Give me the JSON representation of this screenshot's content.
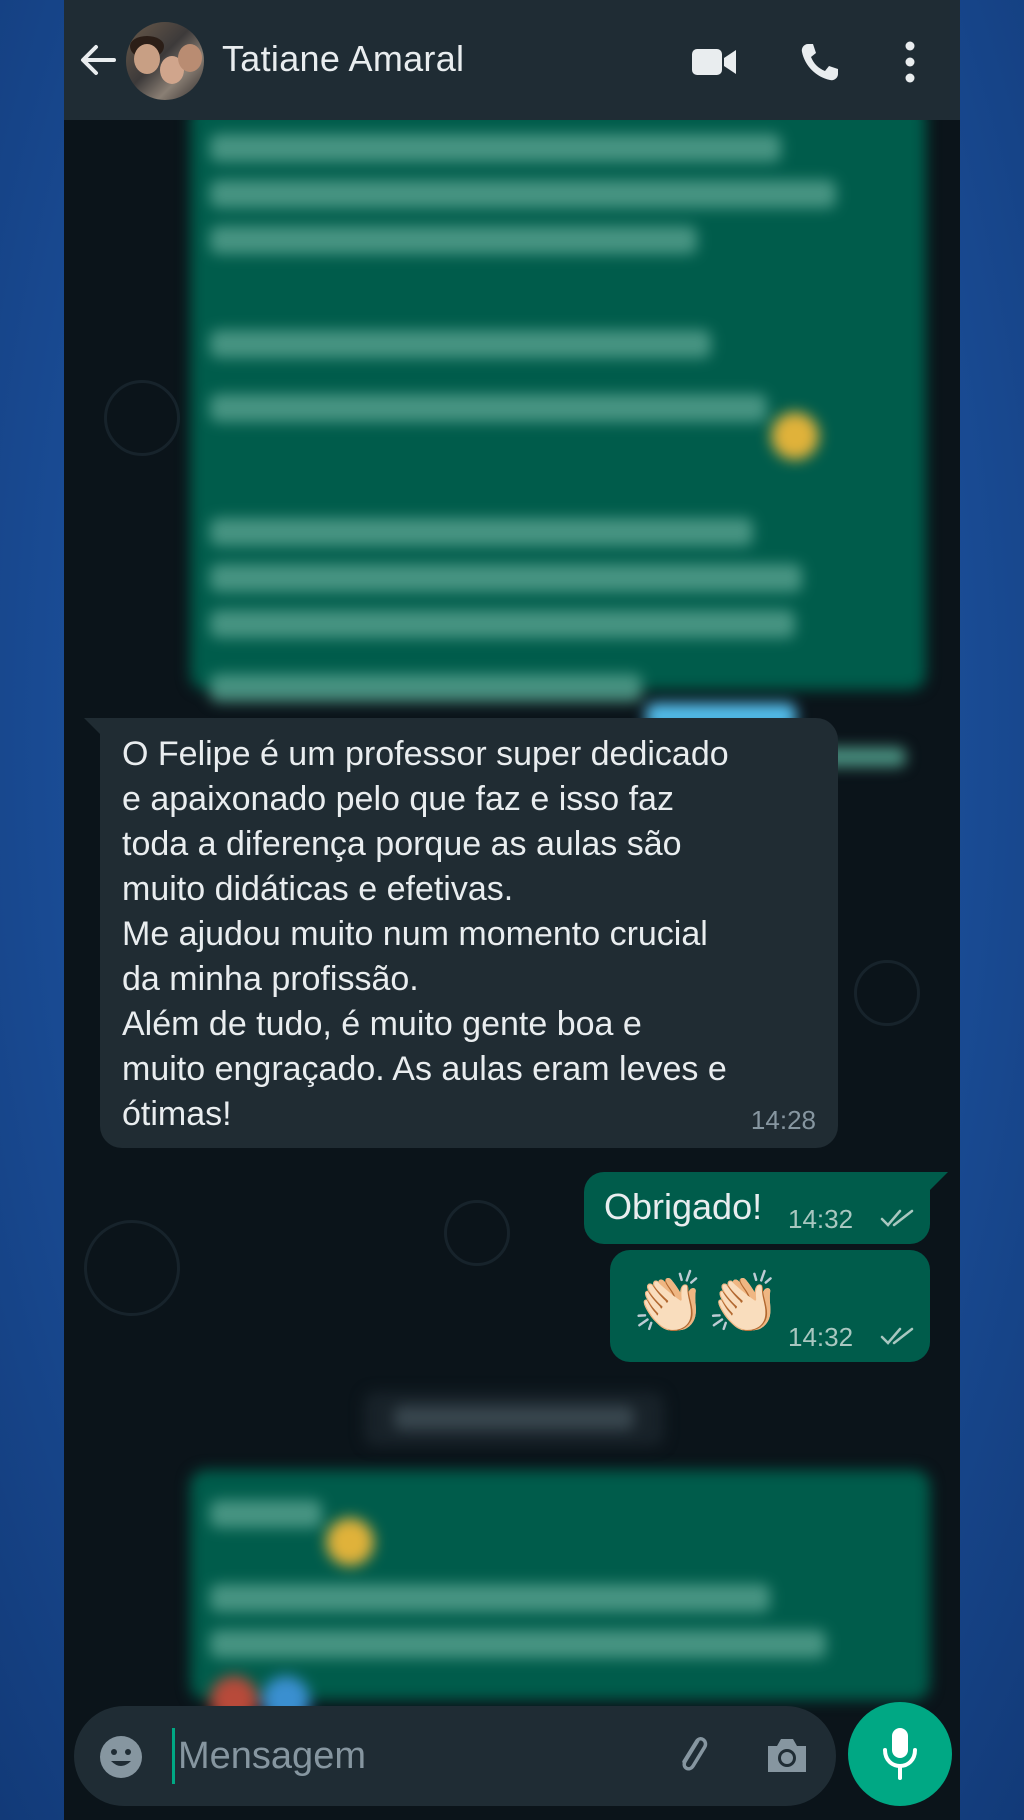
{
  "header": {
    "contact_name": "Tatiane Amaral",
    "icons": [
      "back-arrow-icon",
      "avatar",
      "video-call-icon",
      "phone-call-icon",
      "more-options-icon"
    ]
  },
  "messages": {
    "incoming": {
      "text": "O Felipe é um professor super dedicado\ne apaixonado pelo que faz e isso faz\ntoda a diferença porque as aulas são\nmuito didáticas e efetivas.\nMe ajudou muito num momento crucial\nda minha profissão.\nAlém de tudo, é muito gente boa e\nmuito engraçado. As aulas eram leves e\nótimas!",
      "time": "14:28"
    },
    "outgoing": [
      {
        "text": "Obrigado!",
        "time": "14:32",
        "status": "read"
      },
      {
        "text": "👏🏻👏🏻",
        "time": "14:32",
        "status": "read"
      }
    ]
  },
  "composer": {
    "placeholder": "Mensagem",
    "value": "",
    "icons": [
      "emoji-icon",
      "attach-icon",
      "camera-icon",
      "mic-icon"
    ]
  },
  "colors": {
    "header_bg": "#1f2c34",
    "chat_bg": "#0b141a",
    "incoming_bubble": "#202c33",
    "outgoing_bubble": "#005c4b",
    "accent": "#00a884",
    "page_bg": "#1b4f9a"
  }
}
